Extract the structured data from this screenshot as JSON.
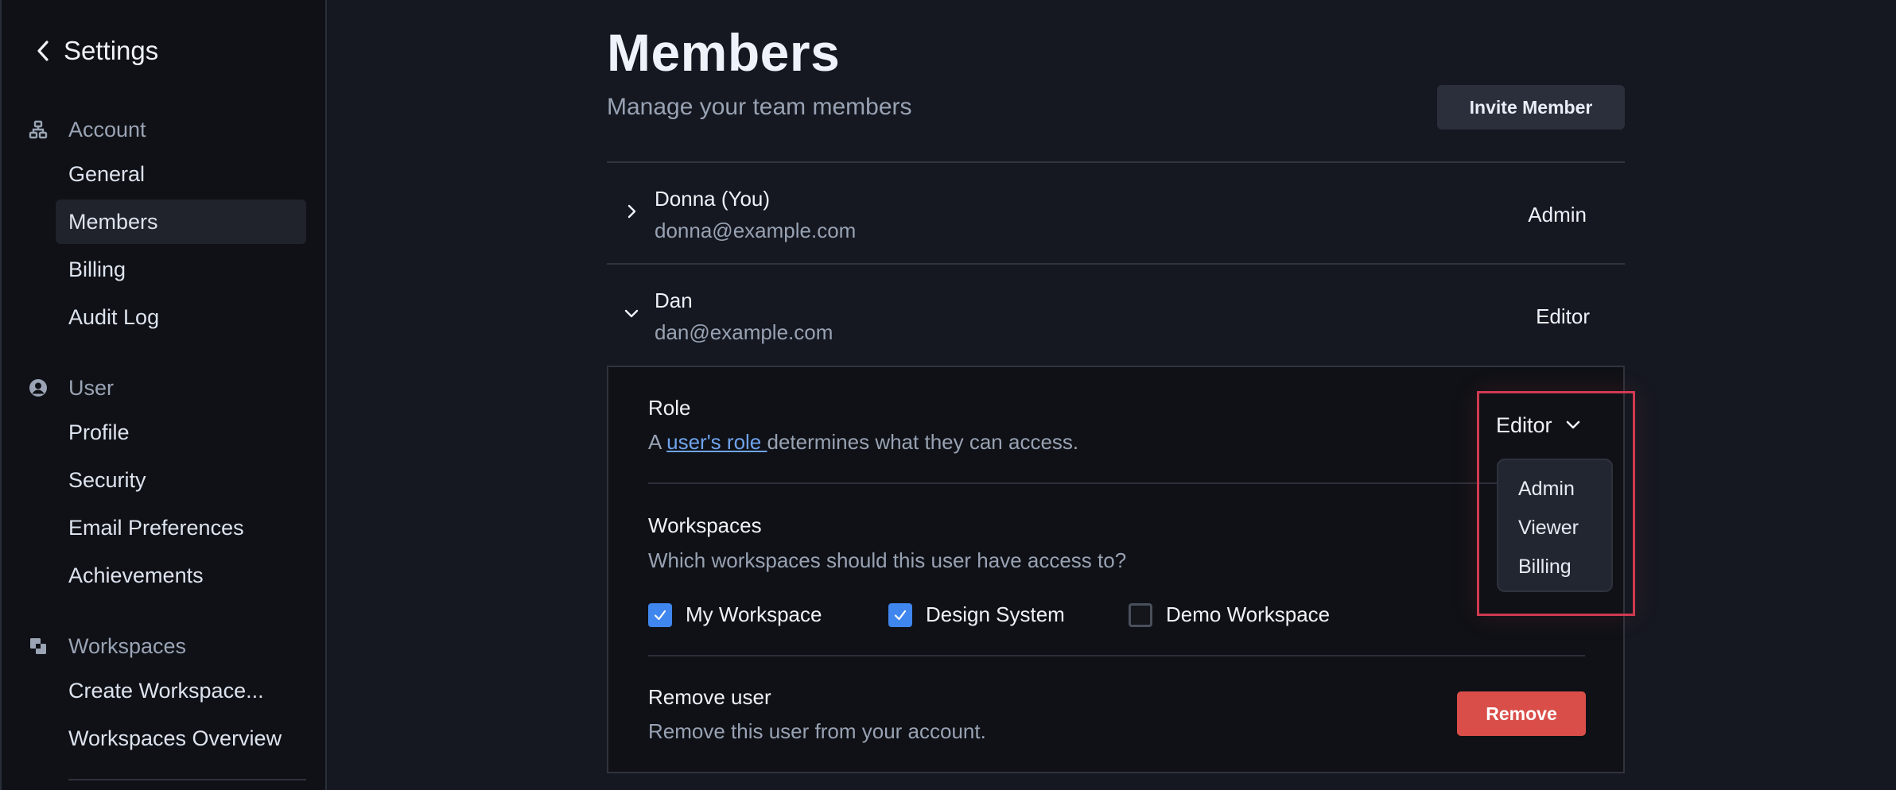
{
  "sidebar": {
    "back_label": "Settings",
    "groups": [
      {
        "label": "Account",
        "icon": "sitemap-icon",
        "items": [
          {
            "label": "General"
          },
          {
            "label": "Members",
            "active": true
          },
          {
            "label": "Billing"
          },
          {
            "label": "Audit Log"
          }
        ]
      },
      {
        "label": "User",
        "icon": "user-circle-icon",
        "items": [
          {
            "label": "Profile"
          },
          {
            "label": "Security"
          },
          {
            "label": "Email Preferences"
          },
          {
            "label": "Achievements"
          }
        ]
      },
      {
        "label": "Workspaces",
        "icon": "overlapping-squares-icon",
        "items": [
          {
            "label": "Create Workspace..."
          },
          {
            "label": "Workspaces Overview"
          }
        ]
      }
    ]
  },
  "header": {
    "title": "Members",
    "subtitle": "Manage your team members",
    "invite_label": "Invite Member"
  },
  "members": [
    {
      "name": "Donna (You)",
      "email": "donna@example.com",
      "role": "Admin",
      "expanded": false
    },
    {
      "name": "Dan",
      "email": "dan@example.com",
      "role": "Editor",
      "expanded": true
    }
  ],
  "detail": {
    "role_title": "Role",
    "role_desc_prefix": "A ",
    "role_desc_link": "user's role ",
    "role_desc_suffix": "determines what they can access.",
    "role_value": "Editor",
    "role_options": [
      "Admin",
      "Viewer",
      "Billing"
    ],
    "workspaces_title": "Workspaces",
    "workspaces_desc": "Which workspaces should this user have access to?",
    "workspaces": [
      {
        "label": "My Workspace",
        "checked": true
      },
      {
        "label": "Design System",
        "checked": true
      },
      {
        "label": "Demo Workspace",
        "checked": false
      }
    ],
    "remove_title": "Remove user",
    "remove_desc": "Remove this user from your account.",
    "remove_label": "Remove"
  },
  "colors": {
    "accent": "#3f86ee",
    "danger": "#d94e49",
    "link": "#6fa4ef",
    "highlight": "#d13a52"
  }
}
